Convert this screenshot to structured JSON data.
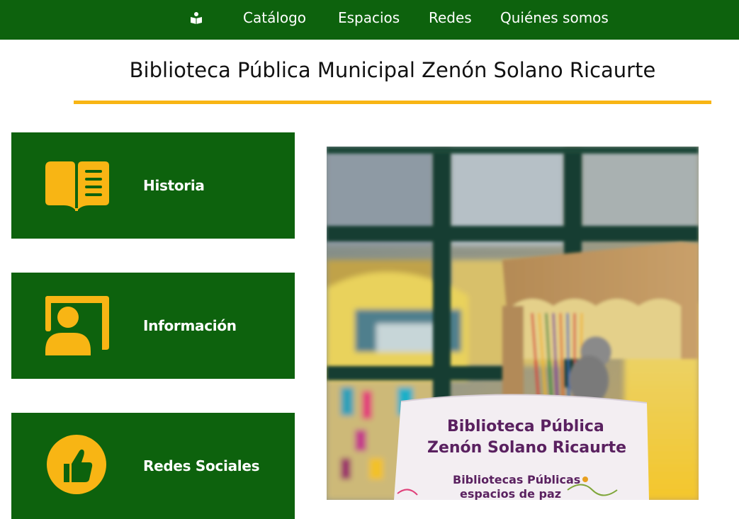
{
  "nav": {
    "logo_icon": "book-reader-icon",
    "items": [
      "Catálogo",
      "Espacios",
      "Redes",
      "Quiénes somos"
    ]
  },
  "page": {
    "title": "Biblioteca Pública Municipal Zenón Solano Ricaurte"
  },
  "cards": [
    {
      "label": "Historia",
      "icon": "open-book-icon"
    },
    {
      "label": "Información",
      "icon": "user-board-icon"
    },
    {
      "label": "Redes Sociales",
      "icon": "thumbs-up-icon"
    }
  ],
  "photo": {
    "sign_line1": "Biblioteca Pública",
    "sign_line2": "Zenón Solano Ricaurte",
    "sign_line3": "Bibliotecas Públicas",
    "sign_line4": "espacios de paz"
  },
  "colors": {
    "brand_green": "#0d620d",
    "accent_yellow": "#f8b514",
    "sign_purple": "#5a2160"
  }
}
